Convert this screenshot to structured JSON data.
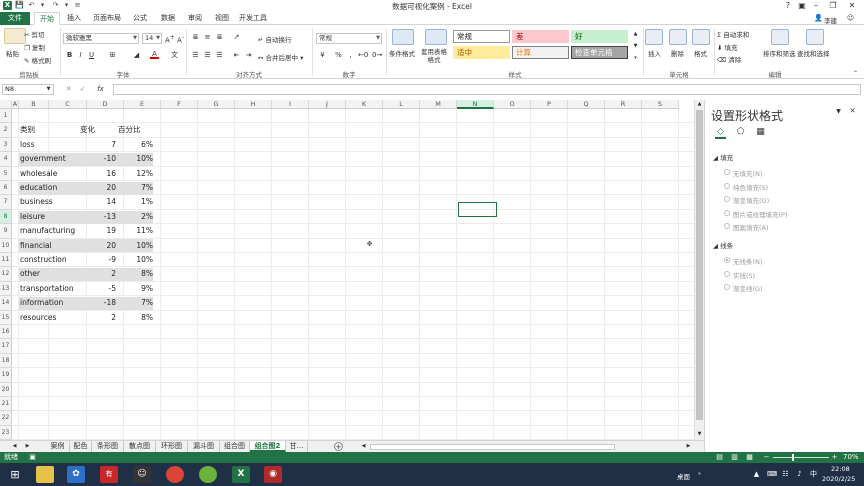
{
  "window": {
    "title": "数据可视化案例 - Excel",
    "help": "?",
    "user": "李建"
  },
  "tabs": [
    "文件",
    "开始",
    "插入",
    "页面布局",
    "公式",
    "数据",
    "审阅",
    "视图",
    "开发工具"
  ],
  "ribbon": {
    "clipboard": {
      "paste": "粘贴",
      "cut": "剪切",
      "copy": "复制",
      "format_painter": "格式刷",
      "label": "剪贴板"
    },
    "font": {
      "name": "微软雅黑",
      "size": "14",
      "label": "字体",
      "bold": "B",
      "italic": "I",
      "underline": "U"
    },
    "alignment": {
      "wrap": "自动换行",
      "merge": "合并后居中",
      "label": "对齐方式"
    },
    "number": {
      "format": "常规",
      "label": "数字",
      "percent": "%",
      "comma": ","
    },
    "styles": {
      "cond_format": "条件格式",
      "table_format": "套用表格格式",
      "cells": [
        {
          "text": "常规",
          "bg": "#ffffff",
          "fg": "#222222",
          "border": "#9a9a9a"
        },
        {
          "text": "差",
          "bg": "#ffc7ce",
          "fg": "#9c0006",
          "border": "#ffc7ce"
        },
        {
          "text": "好",
          "bg": "#c6efce",
          "fg": "#006100",
          "border": "#c6efce"
        },
        {
          "text": "适中",
          "bg": "#ffeb9c",
          "fg": "#9c5700",
          "border": "#ffeb9c"
        },
        {
          "text": "计算",
          "bg": "#f2f2f2",
          "fg": "#fa7d00",
          "border": "#7f7f7f"
        },
        {
          "text": "检查单元格",
          "bg": "#a5a5a5",
          "fg": "#ffffff",
          "border": "#3f3f3f"
        }
      ],
      "label": "样式"
    },
    "cells_grp": {
      "insert": "插入",
      "delete": "删除",
      "format": "格式",
      "label": "单元格"
    },
    "editing": {
      "autosum": "自动求和",
      "fill": "填充",
      "clear": "清除",
      "sort": "排序和筛选",
      "find": "查找和选择",
      "label": "编辑"
    }
  },
  "formula_bar": {
    "name_box": "N8",
    "fx": "fx"
  },
  "columns": [
    "A",
    "B",
    "C",
    "D",
    "E",
    "F",
    "G",
    "H",
    "I",
    "J",
    "K",
    "L",
    "M",
    "N",
    "O",
    "P",
    "Q",
    "R",
    "S"
  ],
  "rows": [
    "1",
    "2",
    "3",
    "4",
    "5",
    "6",
    "7",
    "8",
    "9",
    "10",
    "11",
    "12",
    "13",
    "14",
    "15",
    "16",
    "17",
    "18",
    "19",
    "20",
    "21",
    "22",
    "23"
  ],
  "selected": {
    "column": "N",
    "row": "8"
  },
  "table": {
    "headers": [
      "类别",
      "变化",
      "百分比"
    ],
    "rows": [
      {
        "category": "loss",
        "change": "7",
        "pct": "6%"
      },
      {
        "category": "government",
        "change": "-10",
        "pct": "10%"
      },
      {
        "category": "wholesale",
        "change": "16",
        "pct": "12%"
      },
      {
        "category": "education",
        "change": "20",
        "pct": "7%"
      },
      {
        "category": "business",
        "change": "14",
        "pct": "1%"
      },
      {
        "category": "leisure",
        "change": "-13",
        "pct": "2%"
      },
      {
        "category": "manufacturing",
        "change": "19",
        "pct": "11%"
      },
      {
        "category": "financial",
        "change": "20",
        "pct": "10%"
      },
      {
        "category": "construction",
        "change": "-9",
        "pct": "10%"
      },
      {
        "category": "other",
        "change": "2",
        "pct": "8%"
      },
      {
        "category": "transportation",
        "change": "-5",
        "pct": "9%"
      },
      {
        "category": "information",
        "change": "-18",
        "pct": "7%"
      },
      {
        "category": "resources",
        "change": "2",
        "pct": "8%"
      }
    ]
  },
  "sheet_tabs": [
    "案例",
    "配色",
    "条形图",
    "散点图",
    "环形图",
    "漏斗图",
    "组合图",
    "组合图2",
    "甘..."
  ],
  "active_sheet": "组合图2",
  "status": {
    "ready": "就绪",
    "zoom": "70%"
  },
  "pane": {
    "title": "设置形状格式",
    "fill_section": "填充",
    "fill_options": [
      "无填充(N)",
      "纯色填充(S)",
      "渐变填充(G)",
      "图片或纹理填充(P)",
      "图案填充(A)"
    ],
    "line_section": "线条",
    "line_options": [
      "无线条(N)",
      "实线(S)",
      "渐变线(G)"
    ]
  },
  "taskbar": {
    "time": "22:08",
    "date": "2020/2/25",
    "desktop": "桌面"
  },
  "colors": {
    "excel_green": "#217346",
    "band_gray": "#e0e0e0"
  }
}
